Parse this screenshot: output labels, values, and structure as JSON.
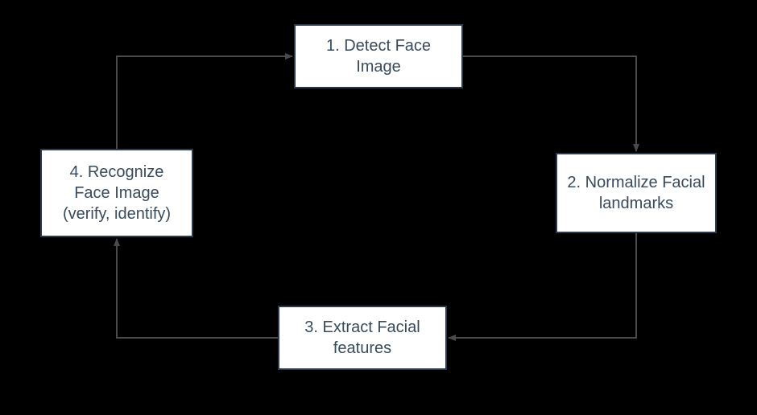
{
  "diagram": {
    "type": "flowchart-cycle",
    "nodes": {
      "n1": {
        "label": "1. Detect Face Image"
      },
      "n2": {
        "label": "2. Normalize Facial landmarks"
      },
      "n3": {
        "label": "3. Extract Facial features"
      },
      "n4": {
        "label": "4. Recognize Face Image (verify, identify)"
      }
    },
    "edges": [
      {
        "from": "n1",
        "to": "n2"
      },
      {
        "from": "n2",
        "to": "n3"
      },
      {
        "from": "n3",
        "to": "n4"
      },
      {
        "from": "n4",
        "to": "n1"
      }
    ],
    "colors": {
      "background": "#000000",
      "node_fill": "#ffffff",
      "node_border": "#2b3a4a",
      "text": "#384a5c",
      "arrow": "#4a4a4a"
    }
  }
}
